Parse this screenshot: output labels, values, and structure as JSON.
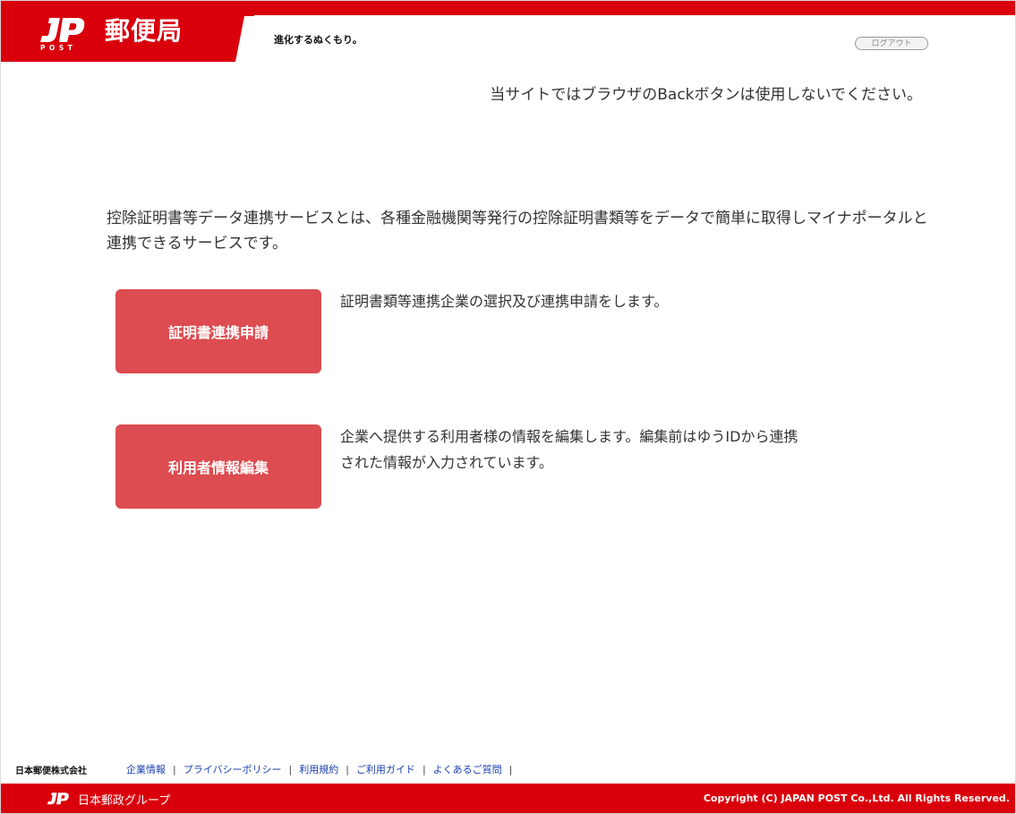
{
  "header": {
    "logo_text": "POST",
    "site_title": "郵便局",
    "tagline": "進化するぬくもり。",
    "logout_label": "ログアウト",
    "back_warning": "当サイトではブラウザのBackボタンは使用しないでください。"
  },
  "main": {
    "intro": "控除証明書等データ連携サービスとは、各種金融機関等発行の控除証明書類等をデータで簡単に取得しマイナポータルと連携できるサービスです。",
    "actions": [
      {
        "label": "証明書連携申請",
        "description": "証明書類等連携企業の選択及び連携申請をします。"
      },
      {
        "label": "利用者情報編集",
        "description": "企業へ提供する利用者様の情報を編集します。編集前はゆうIDから連携された情報が入力されています。"
      }
    ]
  },
  "footer": {
    "company_name": "日本郵便株式会社",
    "links": [
      "企業情報",
      "プライバシーポリシー",
      "利用規約",
      "ご利用ガイド",
      "よくあるご質問"
    ],
    "separator": "|",
    "group_name": "日本郵政グループ",
    "copyright": "Copyright (C) JAPAN POST Co.,Ltd. All Rights Reserved."
  },
  "colors": {
    "brand_red": "#d9000c",
    "button_red": "#dc4c50",
    "link_blue": "#1a3fb0"
  },
  "icons": {
    "brand_logo": "jp-post-logo-icon",
    "footer_logo": "jp-logo-icon"
  }
}
